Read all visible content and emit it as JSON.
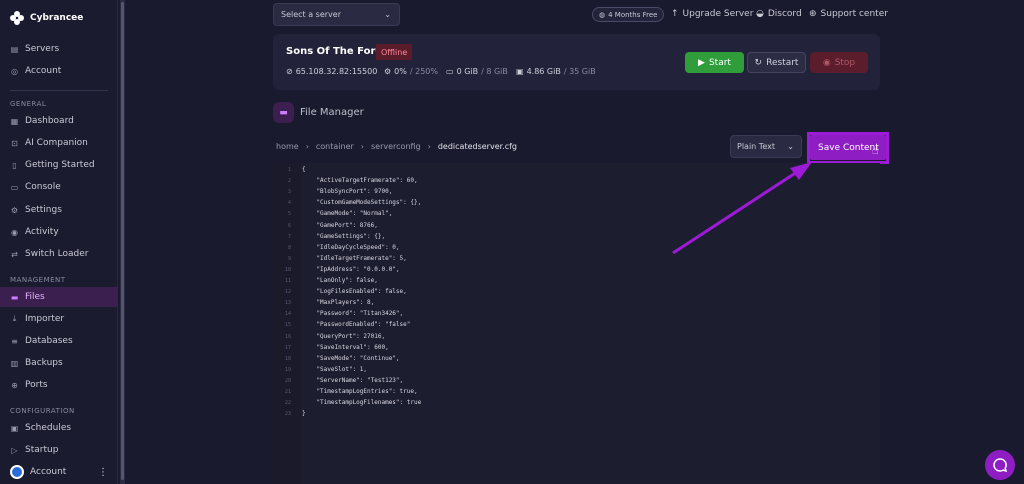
{
  "brand": {
    "name": "Cybrancee"
  },
  "nav": {
    "top": [
      {
        "label": "Servers",
        "icon": "server-icon"
      },
      {
        "label": "Account",
        "icon": "user-icon"
      }
    ],
    "general_label": "GENERAL",
    "general": [
      {
        "label": "Dashboard"
      },
      {
        "label": "AI Companion"
      },
      {
        "label": "Getting Started"
      },
      {
        "label": "Console"
      },
      {
        "label": "Settings"
      },
      {
        "label": "Activity"
      },
      {
        "label": "Switch Loader"
      }
    ],
    "management_label": "MANAGEMENT",
    "management": [
      {
        "label": "Files"
      },
      {
        "label": "Importer"
      },
      {
        "label": "Databases"
      },
      {
        "label": "Backups"
      },
      {
        "label": "Ports"
      }
    ],
    "configuration_label": "CONFIGURATION",
    "configuration": [
      {
        "label": "Schedules"
      },
      {
        "label": "Startup"
      }
    ],
    "account_bottom": "Account"
  },
  "topbar": {
    "server_select_placeholder": "Select a server",
    "free_badge": "4 Months Free",
    "upgrade": "Upgrade Server",
    "discord": "Discord",
    "support": "Support center"
  },
  "server": {
    "name": "Sons Of The Forest",
    "status": "Offline",
    "ip": "65.108.32.82:15500",
    "cpu": "0%",
    "cpu_limit": "/ 250%",
    "ram": "0 GiB",
    "ram_limit": "/ 8 GiB",
    "disk": "4.86 GiB",
    "disk_limit": "/ 35 GiB",
    "start": "Start",
    "restart": "Restart",
    "stop": "Stop"
  },
  "file_manager": {
    "title": "File Manager",
    "breadcrumb": [
      "home",
      "container",
      "serverconfig",
      "dedicatedserver.cfg"
    ],
    "mode": "Plain Text",
    "save": "Save Content"
  },
  "editor": {
    "lines": [
      "{",
      "    \"ActiveTargetFramerate\": 60,",
      "    \"BlobSyncPort\": 9700,",
      "    \"CustomGameModeSettings\": {},",
      "    \"GameMode\": \"Normal\",",
      "    \"GamePort\": 8766,",
      "    \"GameSettings\": {},",
      "    \"IdleDayCycleSpeed\": 0,",
      "    \"IdleTargetFramerate\": 5,",
      "    \"IpAddress\": \"0.0.0.0\",",
      "    \"LanOnly\": false,",
      "    \"LogFilesEnabled\": false,",
      "    \"MaxPlayers\": 8,",
      "    \"Password\": \"Titan3426\",",
      "    \"PasswordEnabled\": \"false\"",
      "    \"QueryPort\": 27016,",
      "    \"SaveInterval\": 600,",
      "    \"SaveMode\": \"Continue\",",
      "    \"SaveSlot\": 1,",
      "    \"ServerName\": \"Test123\",",
      "    \"TimestampLogEntries\": true,",
      "    \"TimestampLogFilenames\": true",
      "}"
    ]
  },
  "colors": {
    "accent": "#8e1ec4",
    "start": "#2f9e3a",
    "offline": "#5a1b2b"
  }
}
